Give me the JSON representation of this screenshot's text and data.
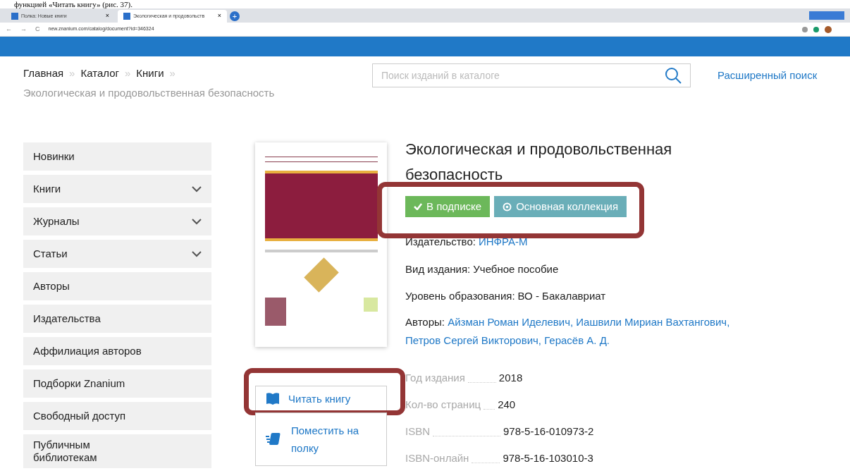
{
  "caption": "функцией «Читать книгу» (рис. 37).",
  "browser": {
    "tabs": [
      {
        "title": "Полка: Новые книги",
        "selected": false,
        "close": "×"
      },
      {
        "title": "Экологическая и продовольств",
        "selected": true,
        "close": "×"
      }
    ],
    "new_tab": "+",
    "nav": [
      "←",
      "→",
      "C"
    ],
    "url": "new.znanium.com/catalog/document?id=346324"
  },
  "breadcrumb": [
    {
      "label": "Главная",
      "current": false
    },
    {
      "separator": "»",
      "label": "Каталог",
      "current": false
    },
    {
      "separator": "»",
      "label": "Книги",
      "current": false
    },
    {
      "separator": "»",
      "label": "Экологическая и продовольственная безопасность",
      "current": true
    }
  ],
  "search": {
    "placeholder": "Поиск изданий в каталоге",
    "advanced_link": "Расширенный поиск"
  },
  "sidebar": {
    "items": [
      {
        "label": "Новинки",
        "kind": "link"
      },
      {
        "label": "Книги",
        "kind": "submenu"
      },
      {
        "label": "Журналы",
        "kind": "submenu"
      },
      {
        "label": "Статьи",
        "kind": "submenu"
      },
      {
        "label": "Авторы",
        "kind": "link"
      },
      {
        "label": "Издательства",
        "kind": "link"
      },
      {
        "label": "Аффилиация авторов",
        "kind": "link"
      },
      {
        "label": "Подборки Znanium",
        "kind": "link"
      },
      {
        "label": "Свободный доступ",
        "kind": "link"
      },
      {
        "label": "Публичным библиотекам",
        "kind": "link"
      }
    ]
  },
  "actions": [
    {
      "label": "Читать книгу",
      "kind": "read",
      "highlighted": true
    },
    {
      "label": "Поместить на полку",
      "kind": "shelf",
      "highlighted": false
    }
  ],
  "book": {
    "title": "Экологическая и продовольственная безопасность",
    "badges_highlighted": true,
    "badges": [
      {
        "label": "В подписке",
        "kind": "check",
        "color": "#6cb85a"
      },
      {
        "label": "Основная коллекция",
        "kind": "circle",
        "color": "#6aaeb8"
      }
    ],
    "publisher": {
      "label": "Издательство:",
      "value": "ИНФРА-М"
    },
    "fields": [
      {
        "label": "Вид издания:",
        "value": "Учебное пособие"
      },
      {
        "label": "Уровень образования:",
        "value": "ВО - Бакалавриат"
      }
    ],
    "authors": {
      "label": "Авторы:",
      "names": [
        "Айзман Роман Иделевич,",
        "Иашвили Мириан Вахтангович,",
        "Петров Сергей Викторович,",
        "Герасёв А. Д."
      ]
    },
    "specs": [
      {
        "label": "Год издания",
        "value": "2018"
      },
      {
        "label": "Кол-во страниц",
        "value": "240"
      },
      {
        "label": "ISBN",
        "value": "978-5-16-010973-2"
      },
      {
        "label": "ISBN-онлайн",
        "value": "978-5-16-103010-3"
      }
    ]
  }
}
